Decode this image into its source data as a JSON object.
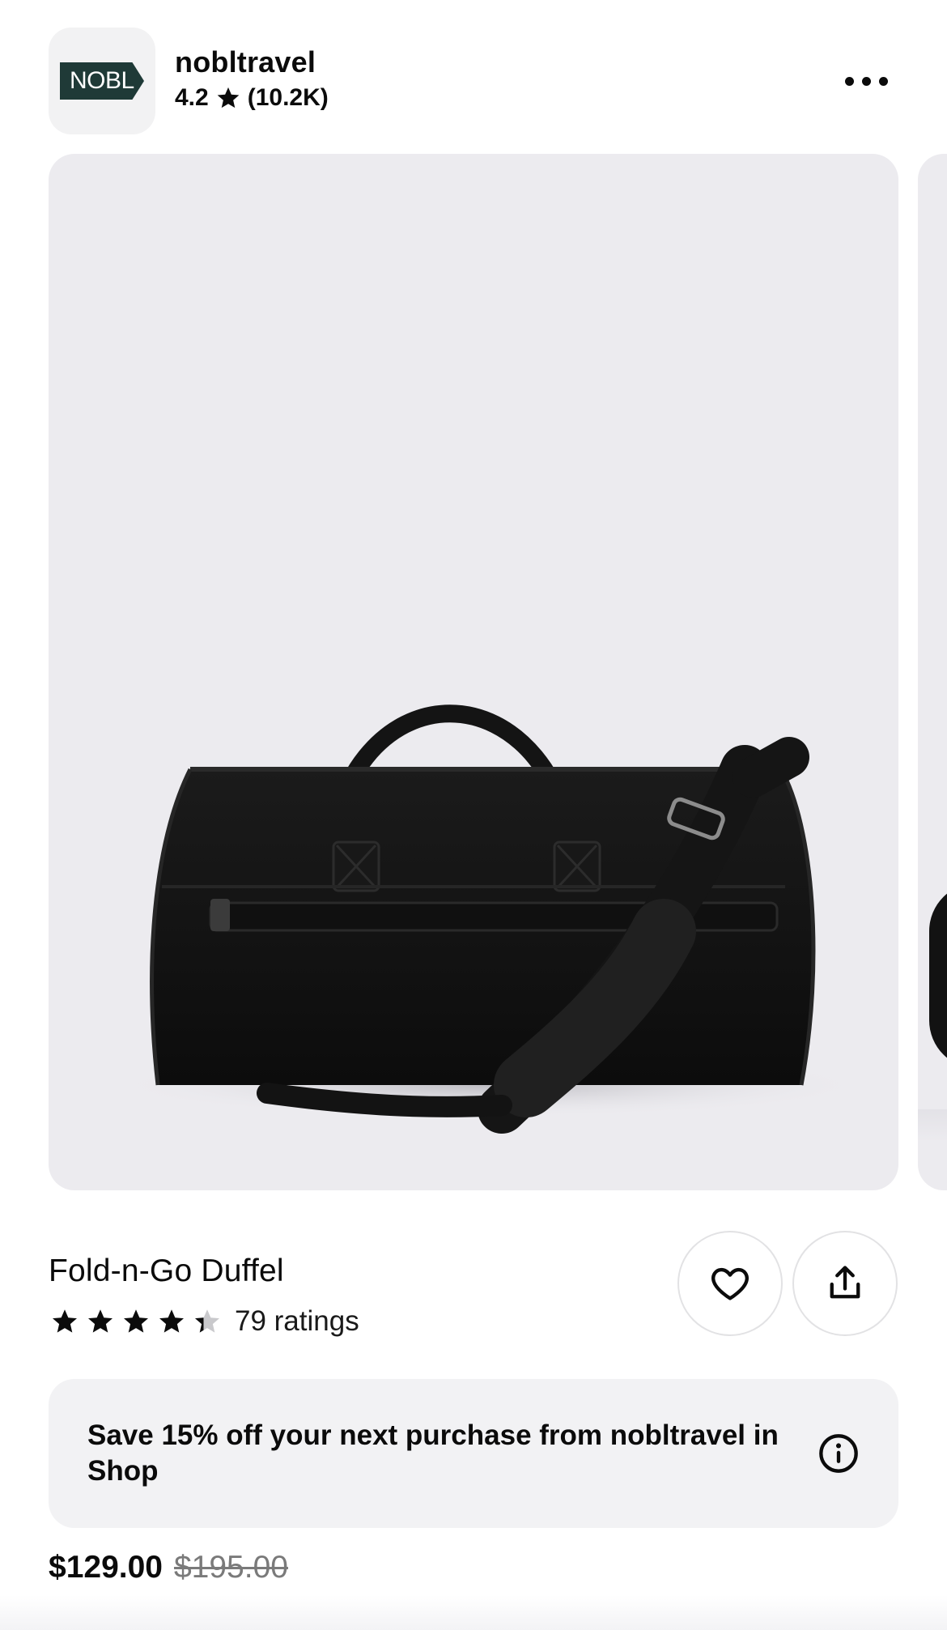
{
  "store": {
    "logo_text": "NOBL",
    "name": "nobltravel",
    "rating": "4.2",
    "review_count": "(10.2K)"
  },
  "header": {
    "more_icon": "more-horizontal-icon"
  },
  "product": {
    "title": "Fold-n-Go Duffel",
    "rating_value": 4.4,
    "ratings_text": "79 ratings",
    "image_description_icon": "duffel-bag-photo"
  },
  "actions": {
    "favorite_icon": "heart-icon",
    "share_icon": "share-icon"
  },
  "promo": {
    "text": "Save 15% off your next purchase from nobltravel in Shop",
    "info_icon": "info-icon"
  },
  "price": {
    "current": "$129.00",
    "original": "$195.00"
  },
  "colors": {
    "logo_bg": "#1f3a37",
    "image_bg": "#ecebef",
    "promo_bg": "#f2f2f4",
    "star_filled": "#0b0b0b",
    "star_empty": "#c9c9cc",
    "strike_price": "#7a7a7a"
  }
}
